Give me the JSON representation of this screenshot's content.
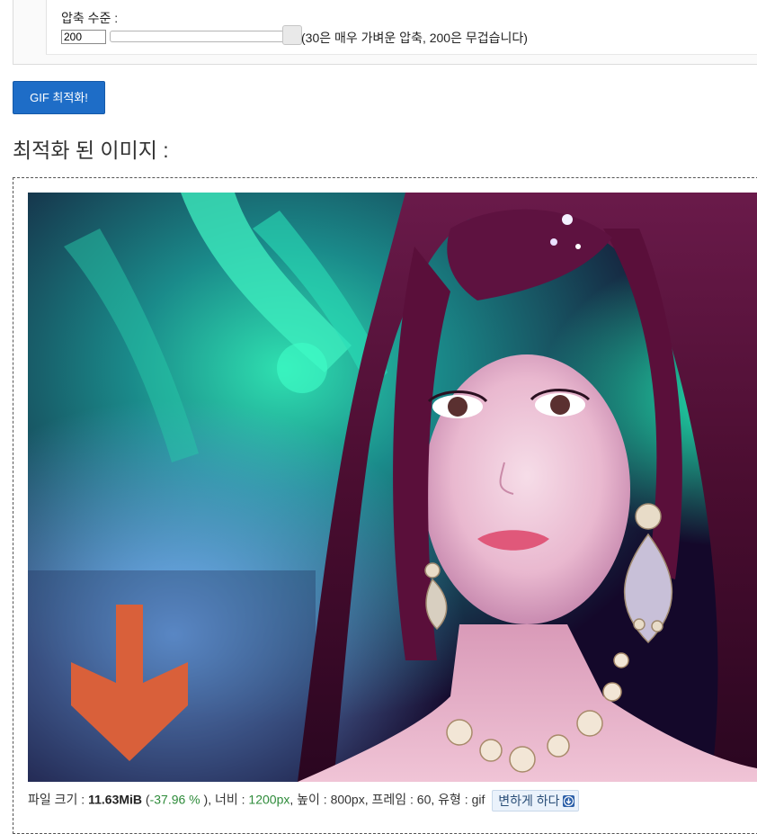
{
  "compression": {
    "label": "압축 수준 :",
    "value": "200",
    "hint": "(30은 매우 가벼운 압축, 200은 무겁습니다)",
    "slider_position": 1.0
  },
  "optimize_button": {
    "label": "GIF 최적화!"
  },
  "result": {
    "title": "최적화 된 이미지 :",
    "image_subject": "photo of woman with dark red hair and jeweled earrings, teal background, orange down-arrow overlay",
    "info": {
      "size_label": "파일 크기 :",
      "size_value": "11.63MiB",
      "change_open": "(",
      "change_value": "-37.96 %",
      "change_close": "),",
      "width_label": "너비 :",
      "width_value": "1200px",
      "height_text": ", 높이 : 800px, 프레임 : 60, 유형 : gif",
      "download_label": "변하게 하다"
    }
  },
  "colors": {
    "button_blue": "#1e6dc7",
    "accent_green": "#2e8b3a",
    "arrow_orange": "#d9603a"
  }
}
